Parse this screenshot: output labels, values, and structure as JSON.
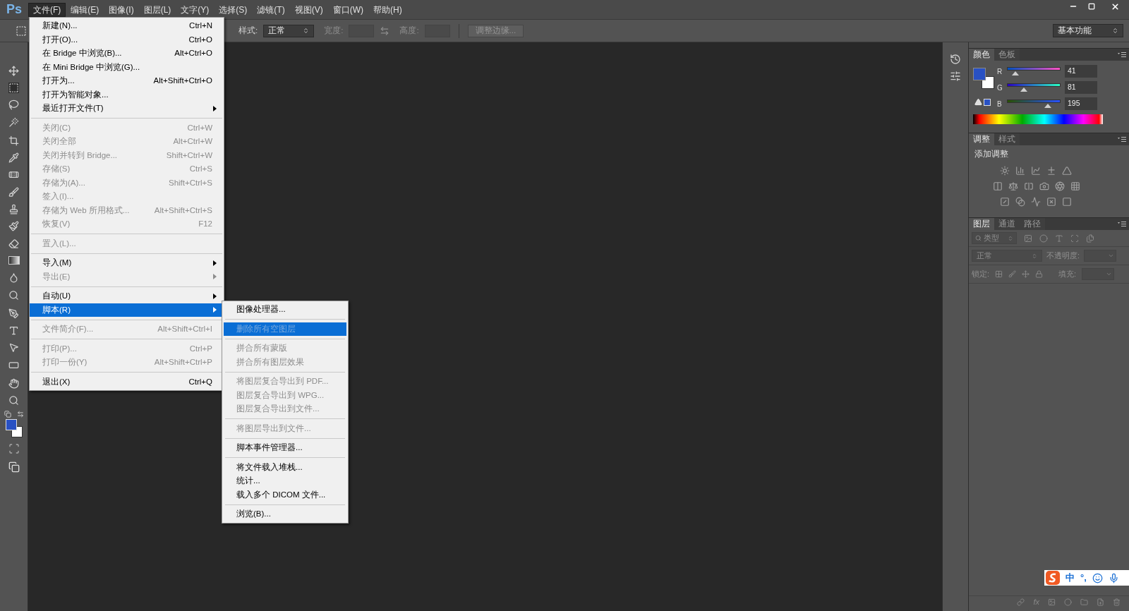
{
  "app_logo": "Ps",
  "menubar": [
    {
      "label": "文件(F)",
      "selected": true
    },
    {
      "label": "编辑(E)",
      "selected": false
    },
    {
      "label": "图像(I)",
      "selected": false
    },
    {
      "label": "图层(L)",
      "selected": false
    },
    {
      "label": "文字(Y)",
      "selected": false
    },
    {
      "label": "选择(S)",
      "selected": false
    },
    {
      "label": "滤镜(T)",
      "selected": false
    },
    {
      "label": "视图(V)",
      "selected": false
    },
    {
      "label": "窗口(W)",
      "selected": false
    },
    {
      "label": "帮助(H)",
      "selected": false
    }
  ],
  "options_bar": {
    "style_label": "样式:",
    "style_value": "正常",
    "width_label": "宽度:",
    "height_label": "高度:",
    "refine_button": "调整边缘...",
    "workspace": "基本功能"
  },
  "file_menu": [
    {
      "kind": "item",
      "label": "新建(N)...",
      "shortcut": "Ctrl+N",
      "disabled": false,
      "submenu": false,
      "selected": false
    },
    {
      "kind": "item",
      "label": "打开(O)...",
      "shortcut": "Ctrl+O",
      "disabled": false,
      "submenu": false,
      "selected": false
    },
    {
      "kind": "item",
      "label": "在 Bridge 中浏览(B)...",
      "shortcut": "Alt+Ctrl+O",
      "disabled": false,
      "submenu": false,
      "selected": false
    },
    {
      "kind": "item",
      "label": "在 Mini Bridge 中浏览(G)...",
      "disabled": false,
      "submenu": false,
      "selected": false
    },
    {
      "kind": "item",
      "label": "打开为...",
      "shortcut": "Alt+Shift+Ctrl+O",
      "disabled": false,
      "submenu": false,
      "selected": false
    },
    {
      "kind": "item",
      "label": "打开为智能对象...",
      "disabled": false,
      "submenu": false,
      "selected": false
    },
    {
      "kind": "item",
      "label": "最近打开文件(T)",
      "disabled": false,
      "submenu": true,
      "selected": false
    },
    {
      "kind": "separator"
    },
    {
      "kind": "item",
      "label": "关闭(C)",
      "shortcut": "Ctrl+W",
      "disabled": true,
      "submenu": false,
      "selected": false
    },
    {
      "kind": "item",
      "label": "关闭全部",
      "shortcut": "Alt+Ctrl+W",
      "disabled": true,
      "submenu": false,
      "selected": false
    },
    {
      "kind": "item",
      "label": "关闭并转到 Bridge...",
      "shortcut": "Shift+Ctrl+W",
      "disabled": true,
      "submenu": false,
      "selected": false
    },
    {
      "kind": "item",
      "label": "存储(S)",
      "shortcut": "Ctrl+S",
      "disabled": true,
      "submenu": false,
      "selected": false
    },
    {
      "kind": "item",
      "label": "存储为(A)...",
      "shortcut": "Shift+Ctrl+S",
      "disabled": true,
      "submenu": false,
      "selected": false
    },
    {
      "kind": "item",
      "label": "签入(I)...",
      "disabled": true,
      "submenu": false,
      "selected": false
    },
    {
      "kind": "item",
      "label": "存储为 Web 所用格式...",
      "shortcut": "Alt+Shift+Ctrl+S",
      "disabled": true,
      "submenu": false,
      "selected": false
    },
    {
      "kind": "item",
      "label": "恢复(V)",
      "shortcut": "F12",
      "disabled": true,
      "submenu": false,
      "selected": false
    },
    {
      "kind": "separator"
    },
    {
      "kind": "item",
      "label": "置入(L)...",
      "disabled": true,
      "submenu": false,
      "selected": false
    },
    {
      "kind": "separator"
    },
    {
      "kind": "item",
      "label": "导入(M)",
      "disabled": false,
      "submenu": true,
      "selected": false
    },
    {
      "kind": "item",
      "label": "导出(E)",
      "disabled": true,
      "submenu": true,
      "selected": false
    },
    {
      "kind": "separator"
    },
    {
      "kind": "item",
      "label": "自动(U)",
      "disabled": false,
      "submenu": true,
      "selected": false
    },
    {
      "kind": "item",
      "label": "脚本(R)",
      "disabled": false,
      "submenu": true,
      "selected": true
    },
    {
      "kind": "separator"
    },
    {
      "kind": "item",
      "label": "文件简介(F)...",
      "shortcut": "Alt+Shift+Ctrl+I",
      "disabled": true,
      "submenu": false,
      "selected": false
    },
    {
      "kind": "separator"
    },
    {
      "kind": "item",
      "label": "打印(P)...",
      "shortcut": "Ctrl+P",
      "disabled": true,
      "submenu": false,
      "selected": false
    },
    {
      "kind": "item",
      "label": "打印一份(Y)",
      "shortcut": "Alt+Shift+Ctrl+P",
      "disabled": true,
      "submenu": false,
      "selected": false
    },
    {
      "kind": "separator"
    },
    {
      "kind": "item",
      "label": "退出(X)",
      "shortcut": "Ctrl+Q",
      "disabled": false,
      "submenu": false,
      "selected": false
    }
  ],
  "scripts_submenu": [
    {
      "kind": "item",
      "label": "图像处理器...",
      "disabled": false,
      "selected": false
    },
    {
      "kind": "separator"
    },
    {
      "kind": "item",
      "label": "删除所有空图层",
      "disabled": true,
      "selected": true
    },
    {
      "kind": "separator"
    },
    {
      "kind": "item",
      "label": "拼合所有蒙版",
      "disabled": true,
      "selected": false
    },
    {
      "kind": "item",
      "label": "拼合所有图层效果",
      "disabled": true,
      "selected": false
    },
    {
      "kind": "separator"
    },
    {
      "kind": "item",
      "label": "将图层复合导出到 PDF...",
      "disabled": true,
      "selected": false
    },
    {
      "kind": "item",
      "label": "图层复合导出到 WPG...",
      "disabled": true,
      "selected": false
    },
    {
      "kind": "item",
      "label": "图层复合导出到文件...",
      "disabled": true,
      "selected": false
    },
    {
      "kind": "separator"
    },
    {
      "kind": "item",
      "label": "将图层导出到文件...",
      "disabled": true,
      "selected": false
    },
    {
      "kind": "separator"
    },
    {
      "kind": "item",
      "label": "脚本事件管理器...",
      "disabled": false,
      "selected": false
    },
    {
      "kind": "separator"
    },
    {
      "kind": "item",
      "label": "将文件载入堆栈...",
      "disabled": false,
      "selected": false
    },
    {
      "kind": "item",
      "label": "统计...",
      "disabled": false,
      "selected": false
    },
    {
      "kind": "item",
      "label": "载入多个 DICOM 文件...",
      "disabled": false,
      "selected": false
    },
    {
      "kind": "separator"
    },
    {
      "kind": "item",
      "label": "浏览(B)...",
      "disabled": false,
      "selected": false
    }
  ],
  "color_panel": {
    "tabs": [
      {
        "label": "颜色",
        "selected": true
      },
      {
        "label": "色板",
        "selected": false
      }
    ],
    "channels": [
      {
        "name": "R",
        "value": "41",
        "level": 0.16
      },
      {
        "name": "G",
        "value": "81",
        "level": 0.32
      },
      {
        "name": "B",
        "value": "195",
        "level": 0.76
      }
    ]
  },
  "adjustments_panel": {
    "tabs": [
      {
        "label": "调整",
        "selected": true
      },
      {
        "label": "样式",
        "selected": false
      }
    ],
    "title": "添加调整"
  },
  "layers_panel": {
    "tabs": [
      {
        "label": "图层",
        "selected": true
      },
      {
        "label": "通道",
        "selected": false
      },
      {
        "label": "路径",
        "selected": false
      }
    ],
    "filter": "类型",
    "blend_mode": "正常",
    "opacity_label": "不透明度:",
    "lock_label": "锁定:",
    "fill_label": "填充:",
    "fx_label": "fx"
  },
  "ime_bar": {
    "items": [
      "中",
      "°,"
    ]
  }
}
